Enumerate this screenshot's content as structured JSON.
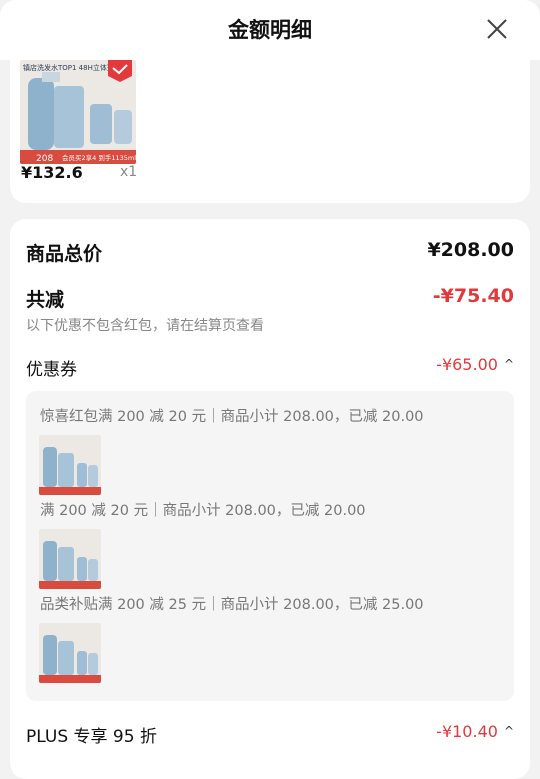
{
  "header": {
    "title": "金额明细"
  },
  "product": {
    "image_caption": "镇店洗发水TOP1 48H立体蓬松",
    "image_badge_price": "208",
    "image_promo": "会员买2享4 到手1135ml",
    "price": "¥132.6",
    "qty": "x1"
  },
  "summary": {
    "total_label": "商品总价",
    "total_value": "¥208.00",
    "discount_label": "共减",
    "discount_value": "-¥75.40",
    "discount_note": "以下优惠不包含红包，请在结算页查看",
    "coupon_label": "优惠券",
    "coupon_value": "-¥65.00",
    "coupon_details": [
      {
        "text": "惊喜红包满 200 减 20 元｜商品小计 208.00，已减 20.00"
      },
      {
        "text": "满 200 减 20 元｜商品小计 208.00，已减 20.00"
      },
      {
        "text": "品类补贴满 200 减 25 元｜商品小计 208.00，已减 25.00"
      }
    ],
    "plus_label": "PLUS 专享 95 折",
    "plus_value": "-¥10.40"
  },
  "colors": {
    "accent_red": "#e4393c",
    "bg": "#f2f2f2"
  },
  "icons": {
    "close": "close-icon",
    "expand": "chevron-up-icon"
  }
}
